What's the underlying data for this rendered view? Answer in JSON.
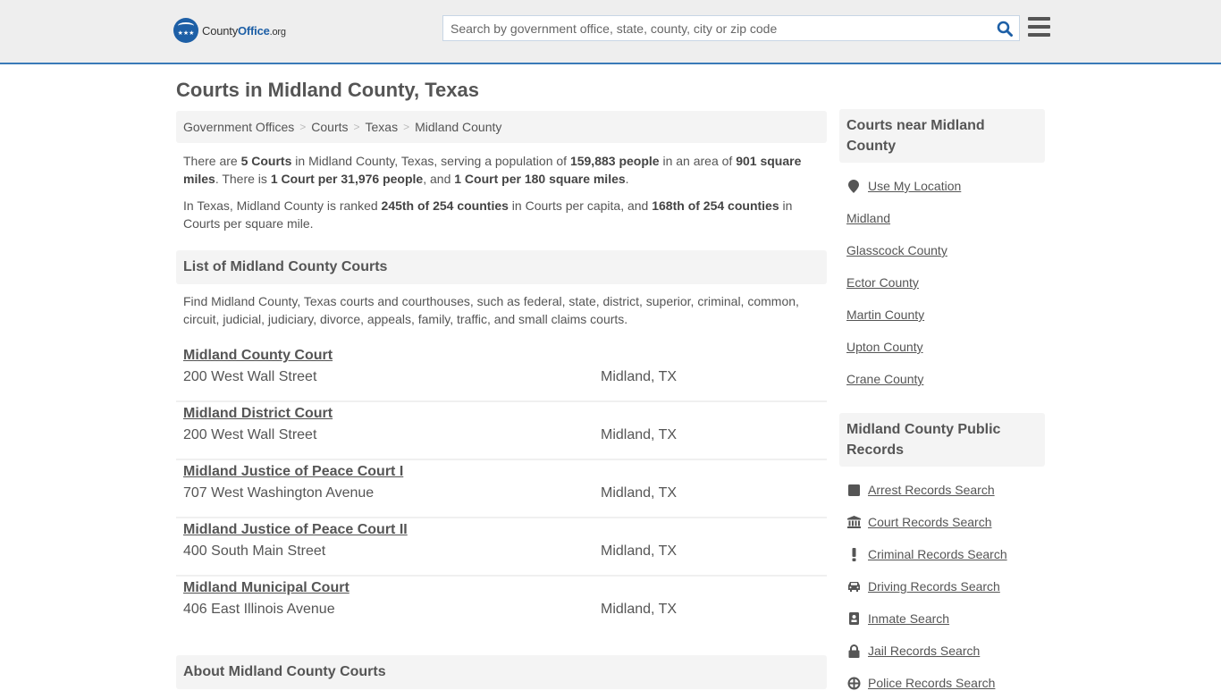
{
  "header": {
    "logo": {
      "name_regular": "County",
      "name_bold": "Office",
      "suffix": ".org"
    },
    "search": {
      "placeholder": "Search by government office, state, county, city or zip code",
      "value": ""
    },
    "icons": {
      "search": "search-icon",
      "menu": "hamburger-menu-icon"
    }
  },
  "page_title": "Courts in Midland County, Texas",
  "breadcrumb": [
    {
      "label": "Government Offices"
    },
    {
      "label": "Courts"
    },
    {
      "label": "Texas"
    },
    {
      "label": "Midland County"
    }
  ],
  "breadcrumb_separator": ">",
  "intro": {
    "p1": {
      "t1": "There are ",
      "b1": "5 Courts",
      "t2": " in Midland County, Texas, serving a population of ",
      "b2": "159,883 people",
      "t3": " in an area of ",
      "b3": "901 square miles",
      "t4": ". There is ",
      "b4": "1 Court per 31,976 people",
      "t5": ", and ",
      "b5": "1 Court per 180 square miles",
      "t6": "."
    },
    "p2": {
      "t1": "In Texas, Midland County is ranked ",
      "b1": "245th of 254 counties",
      "t2": " in Courts per capita, and ",
      "b2": "168th of 254 counties",
      "t3": " in Courts per square mile."
    }
  },
  "list_section": {
    "heading": "List of Midland County Courts",
    "description": "Find Midland County, Texas courts and courthouses, such as federal, state, district, superior, criminal, common, circuit, judicial, judiciary, divorce, appeals, family, traffic, and small claims courts.",
    "courts": [
      {
        "name": "Midland County Court",
        "address": "200 West Wall Street",
        "city": "Midland, TX"
      },
      {
        "name": "Midland District Court",
        "address": "200 West Wall Street",
        "city": "Midland, TX"
      },
      {
        "name": "Midland Justice of Peace Court I",
        "address": "707 West Washington Avenue",
        "city": "Midland, TX"
      },
      {
        "name": "Midland Justice of Peace Court II",
        "address": "400 South Main Street",
        "city": "Midland, TX"
      },
      {
        "name": "Midland Municipal Court",
        "address": "406 East Illinois Avenue",
        "city": "Midland, TX"
      }
    ]
  },
  "about_section": {
    "heading": "About Midland County Courts"
  },
  "sidebar": {
    "nearby": {
      "heading": "Courts near Midland County",
      "use_location": {
        "label": "Use My Location",
        "icon": "map-marker-icon"
      },
      "links": [
        {
          "label": "Midland"
        },
        {
          "label": "Glasscock County"
        },
        {
          "label": "Ector County"
        },
        {
          "label": "Martin County"
        },
        {
          "label": "Upton County"
        },
        {
          "label": "Crane County"
        }
      ]
    },
    "public_records": {
      "heading": "Midland County Public Records",
      "links": [
        {
          "label": "Arrest Records Search",
          "icon": "square-icon"
        },
        {
          "label": "Court Records Search",
          "icon": "courthouse-icon"
        },
        {
          "label": "Criminal Records Search",
          "icon": "exclamation-icon"
        },
        {
          "label": "Driving Records Search",
          "icon": "car-icon"
        },
        {
          "label": "Inmate Search",
          "icon": "id-badge-icon"
        },
        {
          "label": "Jail Records Search",
          "icon": "lock-icon"
        },
        {
          "label": "Police Records Search",
          "icon": "police-badge-icon"
        }
      ]
    }
  },
  "colors": {
    "brand_blue": "#1d5fa6",
    "header_border": "#3a7ab8",
    "text": "#555555",
    "panel_bg": "#f4f4f4"
  }
}
